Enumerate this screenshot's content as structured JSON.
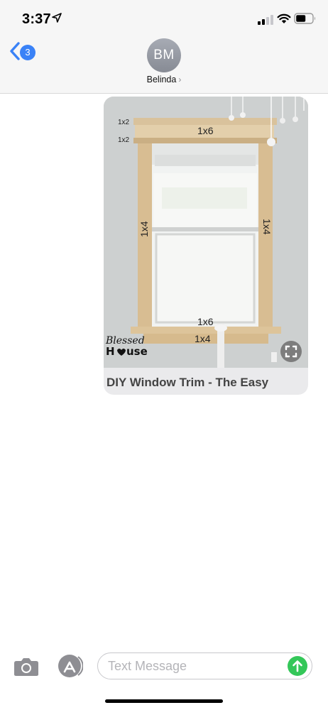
{
  "status_bar": {
    "time": "3:37",
    "icons": [
      "location-arrow-icon",
      "cellular-signal-icon",
      "wifi-icon",
      "battery-icon"
    ]
  },
  "header": {
    "back_badge_count": "3",
    "avatar_initials": "BM",
    "contact_name": "Belinda",
    "contact_chevron": "›"
  },
  "message": {
    "image_labels": {
      "top_left_1": "1x2",
      "top_left_2": "1x2",
      "header_board": "1x6",
      "left_side": "1x4",
      "right_side": "1x4",
      "sill": "1x6",
      "apron": "1x4"
    },
    "watermark": "Blessed House",
    "link_title": "DIY Window Trim - The Easy"
  },
  "composer": {
    "placeholder": "Text Message",
    "value": ""
  },
  "colors": {
    "accent_blue": "#3a82f7",
    "send_green": "#34c759",
    "bar_bg": "#f6f6f6"
  }
}
